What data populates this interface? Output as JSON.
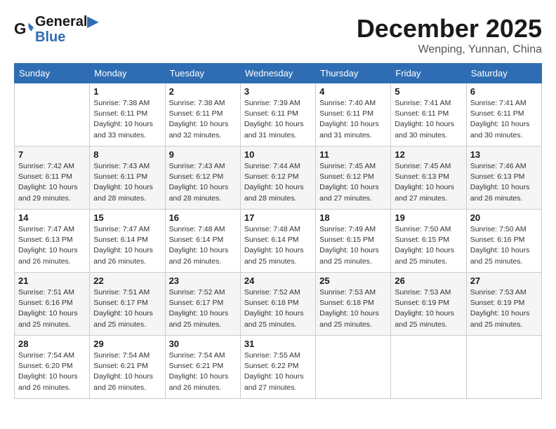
{
  "header": {
    "logo_line1": "General",
    "logo_line2": "Blue",
    "month": "December 2025",
    "location": "Wenping, Yunnan, China"
  },
  "weekdays": [
    "Sunday",
    "Monday",
    "Tuesday",
    "Wednesday",
    "Thursday",
    "Friday",
    "Saturday"
  ],
  "weeks": [
    [
      {
        "day": "",
        "sunrise": "",
        "sunset": "",
        "daylight": ""
      },
      {
        "day": "1",
        "sunrise": "7:38 AM",
        "sunset": "6:11 PM",
        "daylight": "10 hours and 33 minutes."
      },
      {
        "day": "2",
        "sunrise": "7:38 AM",
        "sunset": "6:11 PM",
        "daylight": "10 hours and 32 minutes."
      },
      {
        "day": "3",
        "sunrise": "7:39 AM",
        "sunset": "6:11 PM",
        "daylight": "10 hours and 31 minutes."
      },
      {
        "day": "4",
        "sunrise": "7:40 AM",
        "sunset": "6:11 PM",
        "daylight": "10 hours and 31 minutes."
      },
      {
        "day": "5",
        "sunrise": "7:41 AM",
        "sunset": "6:11 PM",
        "daylight": "10 hours and 30 minutes."
      },
      {
        "day": "6",
        "sunrise": "7:41 AM",
        "sunset": "6:11 PM",
        "daylight": "10 hours and 30 minutes."
      }
    ],
    [
      {
        "day": "7",
        "sunrise": "7:42 AM",
        "sunset": "6:11 PM",
        "daylight": "10 hours and 29 minutes."
      },
      {
        "day": "8",
        "sunrise": "7:43 AM",
        "sunset": "6:11 PM",
        "daylight": "10 hours and 28 minutes."
      },
      {
        "day": "9",
        "sunrise": "7:43 AM",
        "sunset": "6:12 PM",
        "daylight": "10 hours and 28 minutes."
      },
      {
        "day": "10",
        "sunrise": "7:44 AM",
        "sunset": "6:12 PM",
        "daylight": "10 hours and 28 minutes."
      },
      {
        "day": "11",
        "sunrise": "7:45 AM",
        "sunset": "6:12 PM",
        "daylight": "10 hours and 27 minutes."
      },
      {
        "day": "12",
        "sunrise": "7:45 AM",
        "sunset": "6:13 PM",
        "daylight": "10 hours and 27 minutes."
      },
      {
        "day": "13",
        "sunrise": "7:46 AM",
        "sunset": "6:13 PM",
        "daylight": "10 hours and 26 minutes."
      }
    ],
    [
      {
        "day": "14",
        "sunrise": "7:47 AM",
        "sunset": "6:13 PM",
        "daylight": "10 hours and 26 minutes."
      },
      {
        "day": "15",
        "sunrise": "7:47 AM",
        "sunset": "6:14 PM",
        "daylight": "10 hours and 26 minutes."
      },
      {
        "day": "16",
        "sunrise": "7:48 AM",
        "sunset": "6:14 PM",
        "daylight": "10 hours and 26 minutes."
      },
      {
        "day": "17",
        "sunrise": "7:48 AM",
        "sunset": "6:14 PM",
        "daylight": "10 hours and 25 minutes."
      },
      {
        "day": "18",
        "sunrise": "7:49 AM",
        "sunset": "6:15 PM",
        "daylight": "10 hours and 25 minutes."
      },
      {
        "day": "19",
        "sunrise": "7:50 AM",
        "sunset": "6:15 PM",
        "daylight": "10 hours and 25 minutes."
      },
      {
        "day": "20",
        "sunrise": "7:50 AM",
        "sunset": "6:16 PM",
        "daylight": "10 hours and 25 minutes."
      }
    ],
    [
      {
        "day": "21",
        "sunrise": "7:51 AM",
        "sunset": "6:16 PM",
        "daylight": "10 hours and 25 minutes."
      },
      {
        "day": "22",
        "sunrise": "7:51 AM",
        "sunset": "6:17 PM",
        "daylight": "10 hours and 25 minutes."
      },
      {
        "day": "23",
        "sunrise": "7:52 AM",
        "sunset": "6:17 PM",
        "daylight": "10 hours and 25 minutes."
      },
      {
        "day": "24",
        "sunrise": "7:52 AM",
        "sunset": "6:18 PM",
        "daylight": "10 hours and 25 minutes."
      },
      {
        "day": "25",
        "sunrise": "7:53 AM",
        "sunset": "6:18 PM",
        "daylight": "10 hours and 25 minutes."
      },
      {
        "day": "26",
        "sunrise": "7:53 AM",
        "sunset": "6:19 PM",
        "daylight": "10 hours and 25 minutes."
      },
      {
        "day": "27",
        "sunrise": "7:53 AM",
        "sunset": "6:19 PM",
        "daylight": "10 hours and 25 minutes."
      }
    ],
    [
      {
        "day": "28",
        "sunrise": "7:54 AM",
        "sunset": "6:20 PM",
        "daylight": "10 hours and 26 minutes."
      },
      {
        "day": "29",
        "sunrise": "7:54 AM",
        "sunset": "6:21 PM",
        "daylight": "10 hours and 26 minutes."
      },
      {
        "day": "30",
        "sunrise": "7:54 AM",
        "sunset": "6:21 PM",
        "daylight": "10 hours and 26 minutes."
      },
      {
        "day": "31",
        "sunrise": "7:55 AM",
        "sunset": "6:22 PM",
        "daylight": "10 hours and 27 minutes."
      },
      {
        "day": "",
        "sunrise": "",
        "sunset": "",
        "daylight": ""
      },
      {
        "day": "",
        "sunrise": "",
        "sunset": "",
        "daylight": ""
      },
      {
        "day": "",
        "sunrise": "",
        "sunset": "",
        "daylight": ""
      }
    ]
  ],
  "labels": {
    "sunrise": "Sunrise:",
    "sunset": "Sunset:",
    "daylight": "Daylight:"
  }
}
